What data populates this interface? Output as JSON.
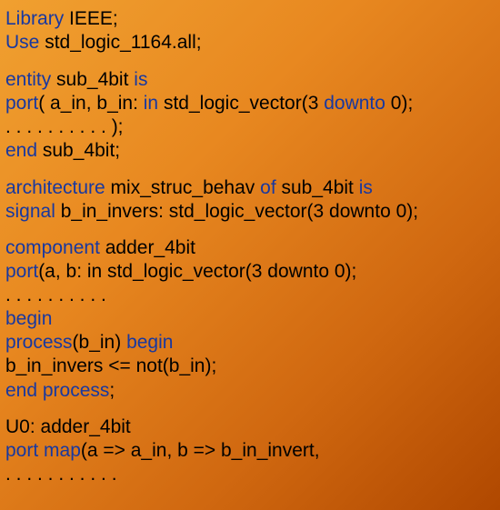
{
  "code": {
    "l1a": "Library",
    "l1b": " IEEE;",
    "l2a": "Use",
    "l2b": " std_logic_1164.all;",
    "l3a": "entity",
    "l3b": " sub_4bit ",
    "l3c": "is",
    "l4a": "     port",
    "l4b": "( a_in, b_in: ",
    "l4c": "in",
    "l4d": " std_logic_vector(3 ",
    "l4e": "downto",
    "l4f": " 0);",
    "l5": "             . . . . . . . . . .    );",
    "l6a": "end",
    "l6b": " sub_4bit;",
    "l7a": "architecture",
    "l7b": " mix_struc_behav ",
    "l7c": "of",
    "l7d": " sub_4bit ",
    "l7e": "is",
    "l8a": "signal",
    "l8b": " b_in_invers: std_logic_vector(3 downto 0);",
    "l9a": "component",
    "l9b": " adder_4bit",
    "l10a": "         port",
    "l10b": "(a, b: in std_logic_vector(3 downto 0);",
    "l11": "               . . . . . . . . . .",
    "l12a": "begin",
    "l13a": "    process",
    "l13b": "(b_in)   ",
    "l13c": "begin",
    "l14": "             b_in_invers <= not(b_in);",
    "l15a": "    end process",
    "l15b": ";",
    "l16": "     U0: adder_4bit",
    "l17a": "             port map",
    "l17b": "(a => a_in, b => b_in_invert,",
    "l18": "   . . . . . . . . . . ."
  }
}
